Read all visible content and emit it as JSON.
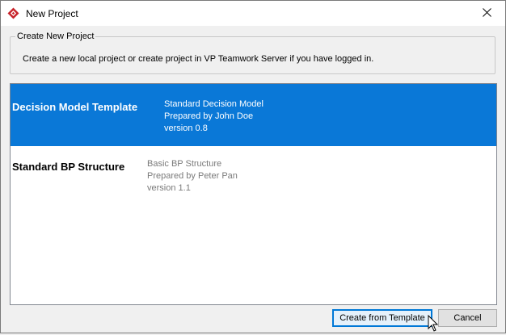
{
  "window": {
    "title": "New Project",
    "icon": "visual-paradigm-logo-icon",
    "close_icon": "close-icon"
  },
  "group": {
    "legend": "Create New Project",
    "description": "Create a new local project or create project in VP Teamwork Server if you have logged in."
  },
  "templates": [
    {
      "name": "Decision Model Template",
      "desc_lines": [
        "Standard Decision Model",
        "Prepared by John Doe",
        "version 0.8"
      ],
      "selected": true
    },
    {
      "name": "Standard BP Structure",
      "desc_lines": [
        "Basic BP Structure",
        "Prepared by Peter Pan",
        "version 1.1"
      ],
      "selected": false
    }
  ],
  "buttons": {
    "create": "Create from Template",
    "cancel": "Cancel"
  },
  "colors": {
    "selection": "#0a78d7",
    "brand": "#c8252c"
  }
}
